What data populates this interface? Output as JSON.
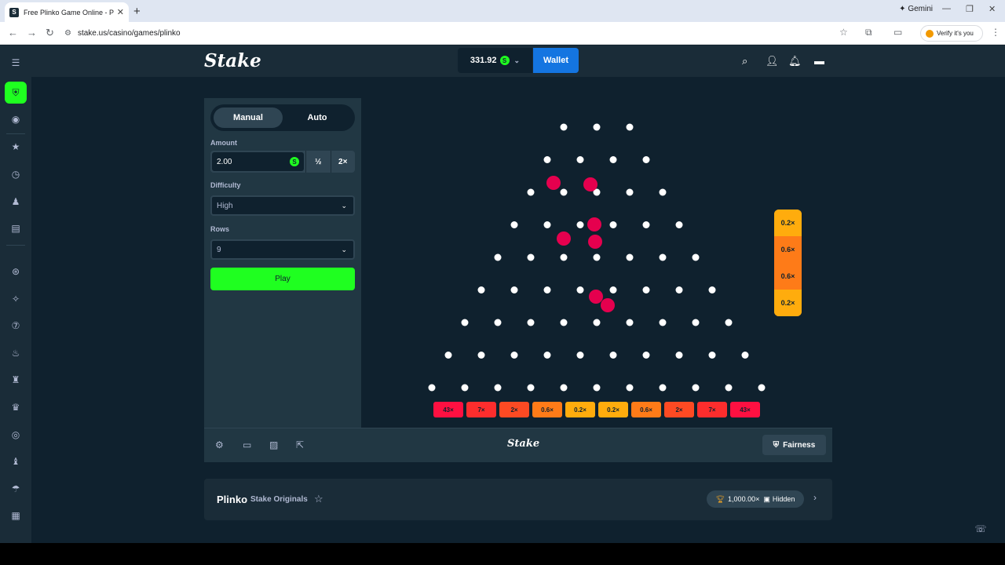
{
  "browser": {
    "tab_title": "Free Plinko Game Online - Play",
    "tab_favicon": "S",
    "new_tab": "+",
    "gemini": "✦ Gemini",
    "url": "stake.us/casino/games/plinko",
    "verify": "Verify it's you"
  },
  "header": {
    "logo": "Stake",
    "balance": "331.92",
    "coin": "S",
    "wallet": "Wallet"
  },
  "controls": {
    "manual": "Manual",
    "auto": "Auto",
    "amount_label": "Amount",
    "amount_value": "2.00",
    "half": "½",
    "double": "2×",
    "difficulty_label": "Difficulty",
    "difficulty_value": "High",
    "rows_label": "Rows",
    "rows_value": "9",
    "play": "Play"
  },
  "board": {
    "rows": 9,
    "multipliers": [
      "43×",
      "7×",
      "2×",
      "0.6×",
      "0.2×",
      "0.2×",
      "0.6×",
      "2×",
      "7×",
      "43×"
    ],
    "multiplier_colors": [
      "#fe1041",
      "#fd2d2d",
      "#fd4a23",
      "#fe7b18",
      "#ffac0d",
      "#ffac0d",
      "#fe7b18",
      "#fd4a23",
      "#fd2d2d",
      "#fe1041"
    ],
    "history": [
      "0.2×",
      "0.6×",
      "0.6×",
      "0.2×"
    ],
    "history_colors": [
      "#ffac0d",
      "#fe7b18",
      "#fe7b18",
      "#ffac0d"
    ]
  },
  "gamebar": {
    "logo": "Stake",
    "fairness": "Fairness"
  },
  "info": {
    "title": "Plinko",
    "subtitle": "Stake Originals",
    "max_win": "1,000.00×",
    "hidden": "Hidden"
  },
  "colors": {
    "accent_green": "#1fff20",
    "wallet_blue": "#1475e1",
    "ball_red": "#e5004e"
  }
}
